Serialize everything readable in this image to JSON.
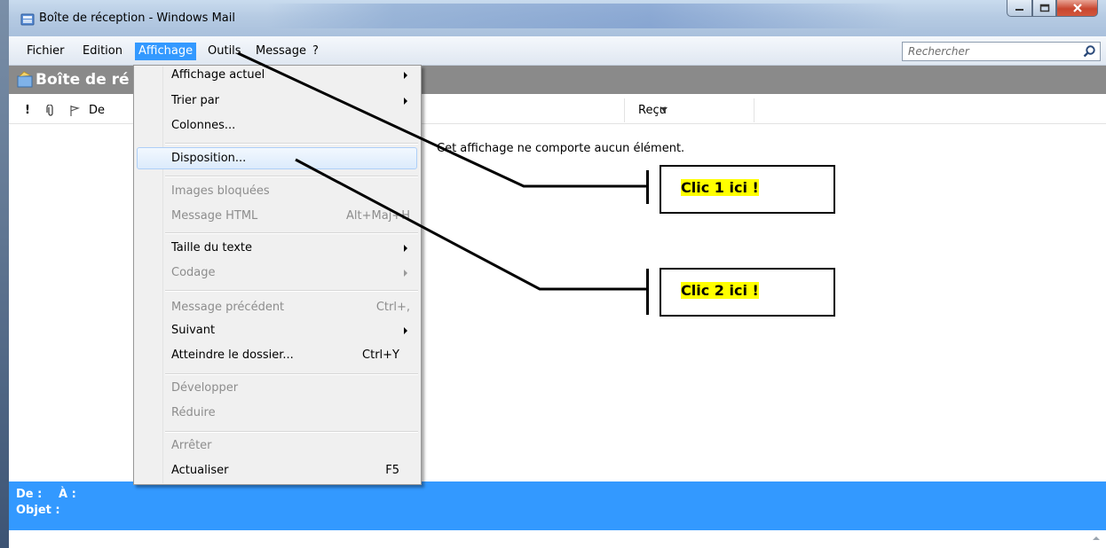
{
  "window": {
    "title": "Boîte de réception - Windows Mail"
  },
  "menubar": {
    "items": [
      "Fichier",
      "Edition",
      "Affichage",
      "Outils",
      "Message",
      "?"
    ],
    "active": "Affichage"
  },
  "search": {
    "placeholder": "Rechercher"
  },
  "folder": {
    "title": "Boîte de ré"
  },
  "columns": {
    "importance": "!",
    "attachment": "🖇",
    "flag": "⚐",
    "from": "De",
    "received": "Reçu"
  },
  "message_list": {
    "empty_text": "Cet affichage ne comporte aucun élément."
  },
  "preview": {
    "from_label": "De :",
    "to_label": "À :",
    "subject_label": "Objet :"
  },
  "dropdown": {
    "items": [
      {
        "label": "Affichage actuel",
        "shortcut": "",
        "submenu": true,
        "disabled": false
      },
      {
        "label": "Trier par",
        "shortcut": "",
        "submenu": true,
        "disabled": false
      },
      {
        "label": "Colonnes...",
        "shortcut": "",
        "submenu": false,
        "disabled": false
      },
      {
        "label": "Disposition...",
        "shortcut": "",
        "submenu": false,
        "disabled": false,
        "highlighted": true
      },
      {
        "label": "Images bloquées",
        "shortcut": "",
        "submenu": false,
        "disabled": true
      },
      {
        "label": "Message HTML",
        "shortcut": "Alt+Maj+H",
        "submenu": false,
        "disabled": true
      },
      {
        "label": "Taille du texte",
        "shortcut": "",
        "submenu": true,
        "disabled": false
      },
      {
        "label": "Codage",
        "shortcut": "",
        "submenu": true,
        "disabled": true
      },
      {
        "label": "Message précédent",
        "shortcut": "Ctrl+,",
        "submenu": false,
        "disabled": true
      },
      {
        "label": "Suivant",
        "shortcut": "",
        "submenu": true,
        "disabled": false
      },
      {
        "label": "Atteindre le dossier...",
        "shortcut": "Ctrl+Y",
        "submenu": false,
        "disabled": false
      },
      {
        "label": "Développer",
        "shortcut": "",
        "submenu": false,
        "disabled": true
      },
      {
        "label": "Réduire",
        "shortcut": "",
        "submenu": false,
        "disabled": true
      },
      {
        "label": "Arrêter",
        "shortcut": "",
        "submenu": false,
        "disabled": true
      },
      {
        "label": "Actualiser",
        "shortcut": "F5",
        "submenu": false,
        "disabled": false
      }
    ]
  },
  "callouts": {
    "click1": "Clic 1 ici !",
    "click2": "Clic 2 ici !"
  },
  "colors": {
    "selection_blue": "#3399ff",
    "folder_bar_gray": "#8a8a8a",
    "callout_highlight": "#ffff00"
  }
}
